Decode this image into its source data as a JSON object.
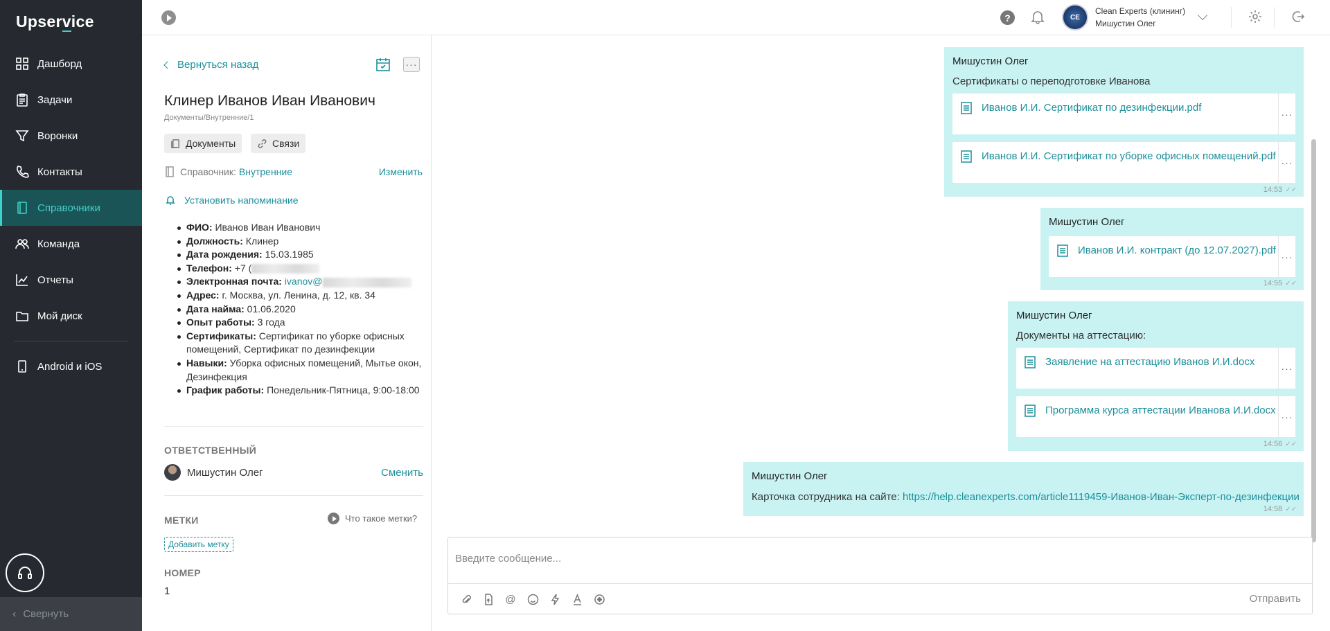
{
  "app": {
    "logo": "Upservice"
  },
  "sidebar": {
    "items": [
      {
        "label": "Дашборд"
      },
      {
        "label": "Задачи"
      },
      {
        "label": "Воронки"
      },
      {
        "label": "Контакты"
      },
      {
        "label": "Справочники",
        "active": true
      },
      {
        "label": "Команда"
      },
      {
        "label": "Отчеты"
      },
      {
        "label": "Мой диск"
      }
    ],
    "mobile": {
      "label": "Android и iOS"
    },
    "collapse_label": "Свернуть"
  },
  "topbar": {
    "help_icon": "?",
    "org_name": "Clean Experts (клининг)",
    "user_name": "Мишустин Олег"
  },
  "card": {
    "back_label": "Вернуться назад",
    "more_label": "···",
    "title": "Клинер Иванов Иван Иванович",
    "path": "Документы/Внутренние/1",
    "tabs": [
      {
        "label": "Документы"
      },
      {
        "label": "Связи"
      }
    ],
    "reference": {
      "label": "Справочник:",
      "value": "Внутренние",
      "change_label": "Изменить"
    },
    "reminder_label": "Установить напоминание",
    "fields": [
      {
        "key": "ФИО:",
        "value": "Иванов Иван Иванович"
      },
      {
        "key": "Должность:",
        "value": "Клинер"
      },
      {
        "key": "Дата рождения:",
        "value": "15.03.1985"
      },
      {
        "key": "Телефон:",
        "value": "+7 ("
      },
      {
        "key": "Электронная почта:",
        "value": "ivanov@"
      },
      {
        "key": "Адрес:",
        "value": "г. Москва, ул. Ленина, д. 12, кв. 34"
      },
      {
        "key": "Дата найма:",
        "value": "01.06.2020"
      },
      {
        "key": "Опыт работы:",
        "value": "3 года"
      },
      {
        "key": "Сертификаты:",
        "value": "Сертификат по уборке офисных помещений, Сертификат по дезинфекции"
      },
      {
        "key": "Навыки:",
        "value": "Уборка офисных помещений, Мытье окон, Дезинфекция"
      },
      {
        "key": "График работы:",
        "value": "Понедельник-Пятница, 9:00-18:00"
      }
    ],
    "responsible": {
      "section_label": "ОТВЕТСТВЕННЫЙ",
      "name": "Мишустин Олег",
      "change_label": "Сменить"
    },
    "tags": {
      "section_label": "МЕТКИ",
      "what_label": "Что такое метки?",
      "add_label": "Добавить метку"
    },
    "number": {
      "section_label": "НОМЕР",
      "value": "1"
    }
  },
  "chat": {
    "messages": [
      {
        "author": "Мишустин Олег",
        "text": "Сертификаты о переподготовке Иванова",
        "files": [
          "Иванов И.И. Сертификат по дезинфекции.pdf",
          "Иванов И.И. Сертификат по уборке офисных помещений.pdf"
        ],
        "time": "14:53"
      },
      {
        "author": "Мишустин Олег",
        "files": [
          "Иванов И.И. контракт (до 12.07.2027).pdf"
        ],
        "time": "14:55"
      },
      {
        "author": "Мишустин Олег",
        "text": "Документы на аттестацию:",
        "files": [
          "Заявление на аттестацию Иванов И.И.docx",
          "Программа курса аттестации Иванова И.И.docx"
        ],
        "time": "14:56"
      },
      {
        "author": "Мишустин Олег",
        "text": "Карточка сотрудника на сайте:",
        "link": "https://help.cleanexperts.com/article1119459-Иванов-Иван-Эксперт-по-дезинфекции",
        "time": "14:58"
      }
    ],
    "composer": {
      "placeholder": "Введите сообщение...",
      "send_label": "Отправить"
    }
  },
  "colors": {
    "accent": "#1d8f9b",
    "sidebar_bg": "#262a30",
    "active_bg": "#1b5457",
    "bubble_bg": "#c9f3f3"
  }
}
